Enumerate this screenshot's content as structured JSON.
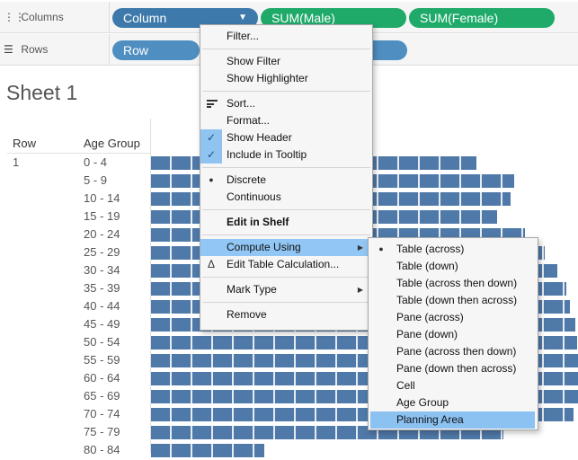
{
  "shelves": {
    "columns": {
      "label": "Columns",
      "icon": "columns-icon",
      "pills": [
        {
          "label": "Column",
          "kind": "dimension"
        },
        {
          "label": "SUM(Male)",
          "kind": "measure"
        },
        {
          "label": "SUM(Female)",
          "kind": "measure"
        }
      ]
    },
    "rows": {
      "label": "Rows",
      "icon": "rows-icon",
      "pills": [
        {
          "label": "Row",
          "kind": "dimension"
        },
        {
          "label": "",
          "kind": "dimension"
        }
      ]
    }
  },
  "sheet": {
    "title": "Sheet 1",
    "headers": {
      "row": "Row",
      "age_group": "Age Group"
    },
    "row_value": "1",
    "age_groups": [
      "0 - 4",
      "5 - 9",
      "10 - 14",
      "15 - 19",
      "20 - 24",
      "25 - 29",
      "30 - 34",
      "35 - 39",
      "40 - 44",
      "45 - 49",
      "50 - 54",
      "55 - 59",
      "60 - 64",
      "65 - 69",
      "70 - 74",
      "75 - 79",
      "80 - 84"
    ],
    "bar_color": "#4f79a8"
  },
  "context_menu": {
    "items": [
      {
        "label": "Filter...",
        "type": "item"
      },
      {
        "type": "sep"
      },
      {
        "label": "Show Filter",
        "type": "item"
      },
      {
        "label": "Show Highlighter",
        "type": "item"
      },
      {
        "type": "sep"
      },
      {
        "label": "Sort...",
        "type": "item",
        "icon": "sort-icon"
      },
      {
        "label": "Format...",
        "type": "item"
      },
      {
        "label": "Show Header",
        "type": "item",
        "checked": true
      },
      {
        "label": "Include in Tooltip",
        "type": "item",
        "checked": true
      },
      {
        "type": "sep"
      },
      {
        "label": "Discrete",
        "type": "item",
        "radio": true
      },
      {
        "label": "Continuous",
        "type": "item"
      },
      {
        "type": "sep"
      },
      {
        "label": "Edit in Shelf",
        "type": "item",
        "bold": true
      },
      {
        "type": "sep"
      },
      {
        "label": "Compute Using",
        "type": "item",
        "submenu": true,
        "highlighted": true
      },
      {
        "label": "Edit Table Calculation...",
        "type": "item",
        "icon": "delta-icon"
      },
      {
        "type": "sep"
      },
      {
        "label": "Mark Type",
        "type": "item",
        "submenu": true
      },
      {
        "type": "sep"
      },
      {
        "label": "Remove",
        "type": "item"
      }
    ]
  },
  "submenu": {
    "items": [
      {
        "label": "Table (across)",
        "radio": true
      },
      {
        "label": "Table (down)"
      },
      {
        "label": "Table (across then down)"
      },
      {
        "label": "Table (down then across)"
      },
      {
        "label": "Pane (across)"
      },
      {
        "label": "Pane (down)"
      },
      {
        "label": "Pane (across then down)"
      },
      {
        "label": "Pane (down then across)"
      },
      {
        "label": "Cell"
      },
      {
        "label": "Age Group"
      },
      {
        "label": "Planning Area",
        "highlighted": true
      }
    ]
  },
  "colors": {
    "dimension_pill": "#4e8ec0",
    "measure_pill": "#1faa6a",
    "menu_highlight": "#91c6f5"
  }
}
